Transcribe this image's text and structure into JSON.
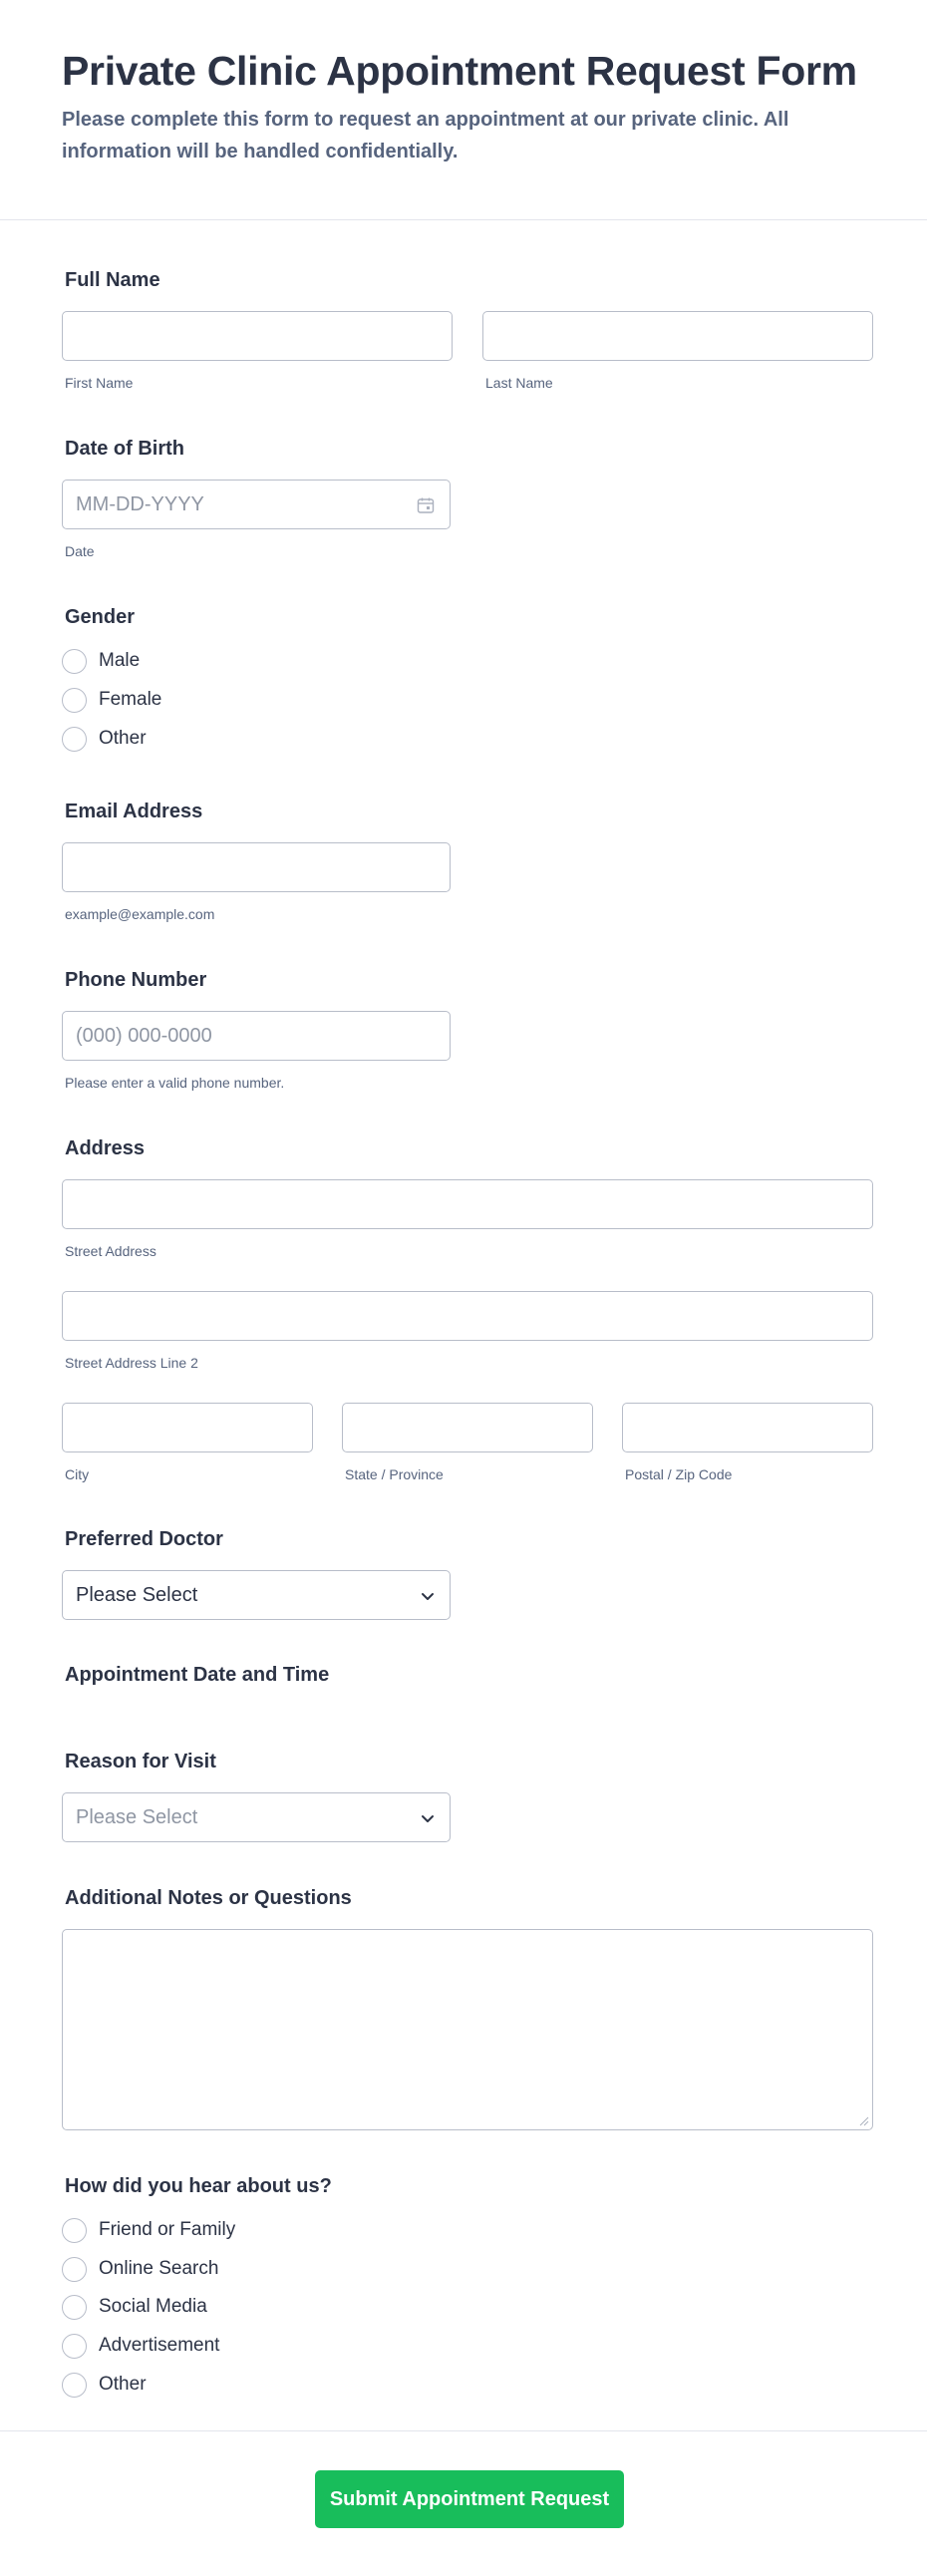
{
  "header": {
    "title": "Private Clinic Appointment Request Form",
    "description": "Please complete this form to request an appointment at our private clinic. All information will be handled confidentially."
  },
  "full_name": {
    "label": "Full Name",
    "first_sublabel": "First Name",
    "last_sublabel": "Last Name"
  },
  "dob": {
    "label": "Date of Birth",
    "placeholder": "MM-DD-YYYY",
    "sublabel": "Date",
    "icon": "calendar-icon"
  },
  "gender": {
    "label": "Gender",
    "options": [
      "Male",
      "Female",
      "Other"
    ]
  },
  "email": {
    "label": "Email Address",
    "sublabel": "example@example.com"
  },
  "phone": {
    "label": "Phone Number",
    "placeholder": "(000) 000-0000",
    "sublabel": "Please enter a valid phone number."
  },
  "address": {
    "label": "Address",
    "street_sublabel": "Street Address",
    "street2_sublabel": "Street Address Line 2",
    "city_sublabel": "City",
    "state_sublabel": "State / Province",
    "postal_sublabel": "Postal / Zip Code"
  },
  "doctor": {
    "label": "Preferred Doctor",
    "selected": "Please Select"
  },
  "appointment": {
    "label": "Appointment Date and Time"
  },
  "reason": {
    "label": "Reason for Visit",
    "selected": "Please Select"
  },
  "notes": {
    "label": "Additional Notes or Questions"
  },
  "heard": {
    "label": "How did you hear about us?",
    "options": [
      "Friend or Family",
      "Online Search",
      "Social Media",
      "Advertisement",
      "Other"
    ]
  },
  "submit": {
    "label": "Submit Appointment Request"
  },
  "colors": {
    "accent": "#18bd5b",
    "text": "#2c3345",
    "muted": "#57647e",
    "border": "#b8bdc9"
  }
}
